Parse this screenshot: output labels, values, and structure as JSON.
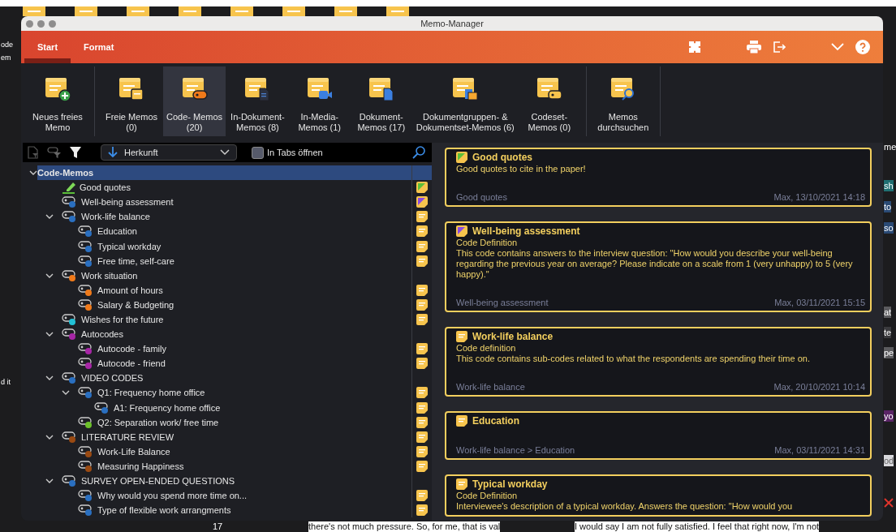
{
  "background_app": {
    "left_texts": [
      "ode",
      "em",
      "d it"
    ],
    "right_texts": [
      {
        "text": "me",
        "color": "#1c1c1e"
      },
      {
        "text": "sh",
        "color": "#1f6f72"
      },
      {
        "text": "to",
        "color": "#2a4a75"
      },
      {
        "text": "so",
        "color": "#2a4a75"
      },
      {
        "text": "at",
        "color": "#5b5b5e"
      },
      {
        "text": "te",
        "color": "#3a3a3d"
      },
      {
        "text": "pe",
        "color": "#5b5b5e"
      },
      {
        "text": "yo",
        "color": "#5a2466"
      },
      {
        "text": "od",
        "color": "#d8d8dc"
      }
    ],
    "line_number": "17",
    "bottom_texts": [
      "there's not much pressure. So, for me, that is val",
      "I would say I am not fully satisfied. I feel that right now, I'm not"
    ]
  },
  "window": {
    "title": "Memo-Manager"
  },
  "tabs": [
    {
      "label": "Start",
      "selected": true
    },
    {
      "label": "Format",
      "selected": false
    }
  ],
  "ribbon": [
    {
      "buttons": [
        {
          "label": "Neues freies\nMemo",
          "kind": "new",
          "selected": false
        }
      ]
    },
    {
      "buttons": [
        {
          "label": "Freie Memos\n(0)",
          "kind": "free",
          "selected": false
        },
        {
          "label": "Code- Memos\n(20)",
          "kind": "code",
          "selected": true
        },
        {
          "label": "In-Dokument-\nMemos (8)",
          "kind": "indoc",
          "selected": false
        },
        {
          "label": "In-Media-\nMemos (1)",
          "kind": "media",
          "selected": false
        },
        {
          "label": "Dokument-\nMemos (17)",
          "kind": "doc",
          "selected": false
        },
        {
          "label": "Dokumentgruppen- &\nDokumentset-Memos (6)",
          "kind": "group",
          "selected": false
        },
        {
          "label": "Codeset-\nMemos (0)",
          "kind": "codeset",
          "selected": false
        }
      ]
    },
    {
      "buttons": [
        {
          "label": "Memos\ndurchsuchen",
          "kind": "search",
          "selected": false
        }
      ]
    }
  ],
  "filter": {
    "sort": "Herkunft",
    "tabs_label": "In Tabs öffnen",
    "tabs_checked": false
  },
  "tree": [
    {
      "label": "Code-Memos",
      "selected": true,
      "expanded": true,
      "has_memo": false,
      "children": [
        {
          "label": "Good quotes",
          "kind": "highlight",
          "color": "#5bbf3a",
          "has_memo": true,
          "memo_tag": {
            "color": "#5bbf3a"
          },
          "selected": false
        },
        {
          "label": "Well-being assessment",
          "kind": "code",
          "color": "#2a6fc0",
          "has_memo": true,
          "memo_tag": {
            "color": "#8a4ae0"
          },
          "selected": false
        },
        {
          "label": "Work-life balance",
          "kind": "code",
          "color": "#2a6fc0",
          "has_memo": true,
          "selected": false,
          "expanded": true,
          "children": [
            {
              "label": "Education",
              "kind": "code",
              "color": "#2a6fc0",
              "has_memo": true,
              "selected": false
            },
            {
              "label": "Typical workday",
              "kind": "code",
              "color": "#2a6fc0",
              "has_memo": true,
              "selected": false
            },
            {
              "label": "Free time, self-care",
              "kind": "code",
              "color": "#2a6fc0",
              "has_memo": true,
              "selected": false
            }
          ]
        },
        {
          "label": "Work situation",
          "kind": "code",
          "color": "#f07a1a",
          "has_memo": false,
          "selected": false,
          "expanded": true,
          "children": [
            {
              "label": "Amount of hours",
              "kind": "code",
              "color": "#f07a1a",
              "has_memo": true,
              "selected": false
            },
            {
              "label": "Salary & Budgeting",
              "kind": "code",
              "color": "#f07a1a",
              "has_memo": true,
              "selected": false
            }
          ]
        },
        {
          "label": "Wishes for the future",
          "kind": "code",
          "color": "#22c1d6",
          "has_memo": true,
          "selected": false
        },
        {
          "label": "Autocodes",
          "kind": "code",
          "color": "#a726a6",
          "has_memo": false,
          "selected": false,
          "expanded": true,
          "children": [
            {
              "label": "Autocode - family",
              "kind": "code",
              "color": "#a726a6",
              "has_memo": true,
              "selected": false
            },
            {
              "label": "Autocode - friend",
              "kind": "code",
              "color": "#a726a6",
              "has_memo": true,
              "selected": false
            }
          ]
        },
        {
          "label": "VIDEO CODES",
          "kind": "code",
          "color": "#2a6fc0",
          "has_memo": false,
          "selected": false,
          "expanded": true,
          "children": [
            {
              "label": "Q1: Frequency home office",
              "kind": "code",
              "color": "#2a6fc0",
              "has_memo": true,
              "selected": false,
              "expanded": true,
              "children": [
                {
                  "label": "A1: Frequency home office",
                  "kind": "code",
                  "color": "#2a6fc0",
                  "has_memo": true,
                  "selected": false
                }
              ]
            },
            {
              "label": "Q2: Separation work/ free time",
              "kind": "code",
              "color": "#6cc02a",
              "has_memo": true,
              "selected": false
            }
          ]
        },
        {
          "label": "LITERATURE REVIEW",
          "kind": "code",
          "color": "#9a4a12",
          "has_memo": true,
          "selected": false,
          "expanded": true,
          "children": [
            {
              "label": "Work-Life Balance",
              "kind": "code",
              "color": "#9a4a12",
              "has_memo": true,
              "selected": false
            },
            {
              "label": "Measuring Happiness",
              "kind": "code",
              "color": "#9a4a12",
              "has_memo": true,
              "selected": false
            }
          ]
        },
        {
          "label": "SURVEY OPEN-ENDED QUESTIONS",
          "kind": "code",
          "color": "#2a6fc0",
          "has_memo": false,
          "selected": false,
          "expanded": true,
          "children": [
            {
              "label": "Why would you spend more time on...",
              "kind": "code",
              "color": "#2a6fc0",
              "has_memo": true,
              "selected": false
            },
            {
              "label": "Type of flexible work arrangments",
              "kind": "code",
              "color": "#2a6fc0",
              "has_memo": true,
              "selected": false
            }
          ]
        }
      ]
    }
  ],
  "memos": [
    {
      "title": "Good quotes",
      "memo_tag": {
        "color": "#5bbf3a"
      },
      "body": "Good quotes to cite in the paper!",
      "source": "Good quotes",
      "author_date": "Max, 13/10/2021 14:18"
    },
    {
      "title": "Well-being assessment",
      "memo_tag": {
        "color": "#8a4ae0"
      },
      "subtitle": "Code Definition",
      "body": "This code contains answers to the interview question: \"How would you describe your well-being regarding the previous year on average? Please indicate on a scale from 1 (very unhappy) to 5 (very happy).\"",
      "source": "Well-being assessment",
      "author_date": "Max, 03/11/2021 15:15"
    },
    {
      "title": "Work-life balance",
      "subtitle": "Code definition",
      "body": "This code contains sub-codes related to what the respondents are spending their time on.",
      "source": "Work-life balance",
      "author_date": "Max, 20/10/2021 10:14"
    },
    {
      "title": "Education",
      "source": "Work-life balance > Education",
      "author_date": "Max, 03/11/2021 14:31"
    },
    {
      "title": "Typical workday",
      "subtitle": "Code Definition",
      "body": "Interviewee's description of a typical workday. Answers the question: \"How would you"
    }
  ]
}
